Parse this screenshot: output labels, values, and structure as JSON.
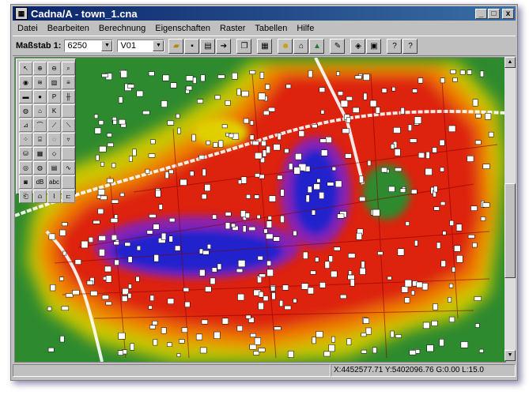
{
  "window": {
    "title": "Cadna/A - town_1.cna",
    "app_icon": "cadna-app-icon"
  },
  "window_controls": {
    "minimize": "_",
    "maximize": "□",
    "close": "x"
  },
  "menu": [
    "Datei",
    "Bearbeiten",
    "Berechnung",
    "Eigenschaften",
    "Raster",
    "Tabellen",
    "Hilfe"
  ],
  "toolbar": {
    "scale_label": "Maßstab 1:",
    "scale_value": "6250",
    "variant_value": "V01"
  },
  "palette": {
    "text_tool": "abc",
    "k_tool": "K",
    "p_tool": "P"
  },
  "status": {
    "coords": "X:4452577.71 Y:5402096.76 G:0.00 L:15.0"
  },
  "colors": {
    "title_start": "#0a246a",
    "title_end": "#3a6ea5",
    "green": "#2e8a2e",
    "red": "#dd2211",
    "blue": "#2020cc"
  }
}
